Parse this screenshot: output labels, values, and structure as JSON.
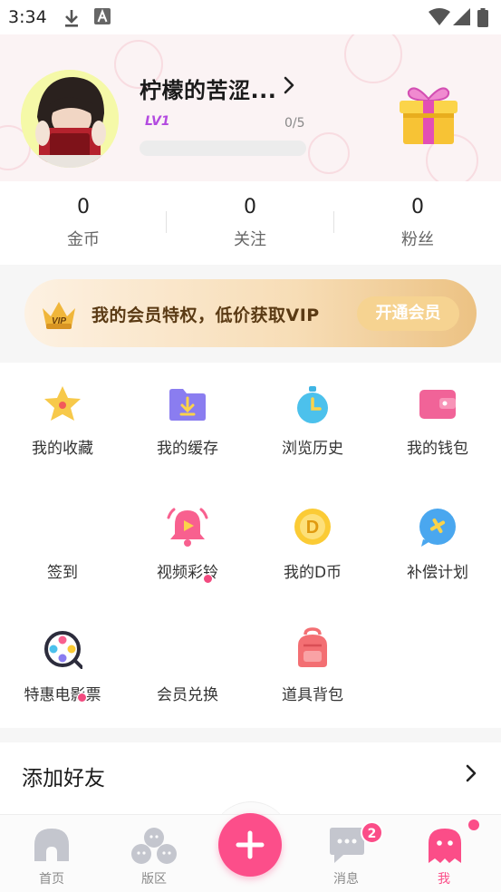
{
  "status_bar": {
    "time": "3:34",
    "icons": [
      "download-icon",
      "font-a-icon",
      "wifi-icon",
      "cellular-signal-icon",
      "battery-icon"
    ]
  },
  "profile": {
    "username": "柠檬的苦涩...",
    "level": "LV1",
    "level_progress_text": "0/5",
    "level_progress_fraction": 0
  },
  "stats": [
    {
      "value": "0",
      "label": "金币"
    },
    {
      "value": "0",
      "label": "关注"
    },
    {
      "value": "0",
      "label": "粉丝"
    }
  ],
  "vip_banner": {
    "badge": "VIP",
    "text": "我的会员特权，低价获取VIP",
    "button_label": "开通会员"
  },
  "grid_items": [
    {
      "label": "我的收藏",
      "icon": "star-badge-icon",
      "has_dot": false
    },
    {
      "label": "我的缓存",
      "icon": "download-folder-icon",
      "has_dot": false
    },
    {
      "label": "浏览历史",
      "icon": "stopwatch-icon",
      "has_dot": false
    },
    {
      "label": "我的钱包",
      "icon": "wallet-icon",
      "has_dot": false
    },
    {
      "label": "签到",
      "icon": "sign-in-icon",
      "has_dot": false
    },
    {
      "label": "视频彩铃",
      "icon": "video-ringtone-bell-icon",
      "has_dot": true
    },
    {
      "label": "我的D币",
      "icon": "d-coin-icon",
      "has_dot": false
    },
    {
      "label": "补偿计划",
      "icon": "compensation-bubble-icon",
      "has_dot": false
    },
    {
      "label": "特惠电影票",
      "icon": "film-reel-icon",
      "has_dot": true
    },
    {
      "label": "会员兑换",
      "icon": "member-exchange-icon",
      "has_dot": false
    },
    {
      "label": "道具背包",
      "icon": "backpack-icon",
      "has_dot": false
    }
  ],
  "add_friend": {
    "label": "添加好友"
  },
  "tabbar": {
    "tabs": [
      {
        "label": "首页",
        "icon": "home-icon"
      },
      {
        "label": "版区",
        "icon": "community-icon"
      },
      {
        "label": "消息",
        "icon": "message-icon",
        "badge": "2"
      },
      {
        "label": "我",
        "icon": "profile-ghost-icon",
        "active": true
      }
    ],
    "plus_icon": "plus-icon"
  },
  "colors": {
    "accent_pink": "#fb4d88",
    "vip_gold": "#f6d391",
    "level_purple": "#b34ae0"
  }
}
